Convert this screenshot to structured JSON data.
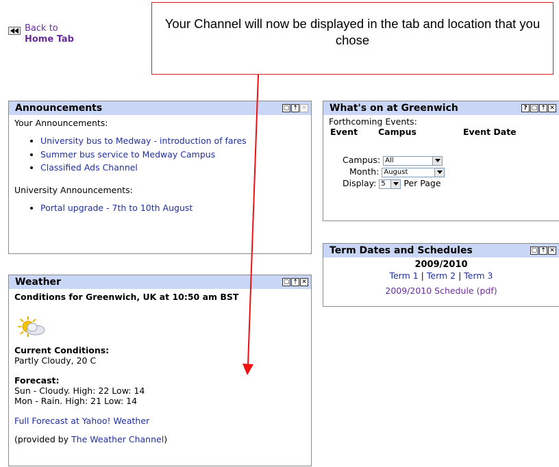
{
  "back": {
    "line1": "Back to",
    "line2": "Home Tab"
  },
  "callout": {
    "text": "Your Channel will now be displayed in the tab and location that you chose"
  },
  "announcements": {
    "title": "Announcements",
    "your_label": "Your Announcements:",
    "your_items": [
      "University bus to Medway - introduction of fares",
      "Summer bus service to Medway Campus",
      "Classified Ads Channel"
    ],
    "univ_label": "University Announcements:",
    "univ_items": [
      "Portal upgrade - 7th to 10th August"
    ]
  },
  "weather": {
    "title": "Weather",
    "conditions_title": "Conditions for Greenwich, UK at 10:50 am BST",
    "current_label": "Current Conditions:",
    "current_value": "Partly Cloudy, 20 C",
    "forecast_label": "Forecast:",
    "forecast": [
      "Sun - Cloudy. High: 22 Low: 14",
      "Mon - Rain. High: 21 Low: 14"
    ],
    "full_forecast_link": "Full Forecast at Yahoo! Weather",
    "provided_prefix": "(provided by ",
    "provided_link": "The Weather Channel",
    "provided_suffix": ")"
  },
  "greenwich": {
    "title": "What's on at Greenwich",
    "forthcoming": "Forthcoming Events:",
    "columns": [
      "Event",
      "Campus",
      "Event Date"
    ],
    "campus_label": "Campus:",
    "campus_value": "All",
    "month_label": "Month:",
    "month_value": "August",
    "display_label": "Display:",
    "display_value": "5",
    "per_page": "Per Page"
  },
  "term": {
    "title": "Term Dates and Schedules",
    "year": "2009/2010",
    "terms": [
      "Term 1",
      "Term 2",
      "Term 3"
    ],
    "separator": " | ",
    "schedule_link": "2009/2010 Schedule (pdf)"
  },
  "icons": {
    "rewind": "rewind-icon",
    "weather": "partly-cloudy-icon",
    "controls": [
      "help-icon",
      "maximize-icon",
      "minimize-icon",
      "close-icon"
    ]
  },
  "colors": {
    "header_bg": "#c9d6f5",
    "link": "#1f2f9e",
    "visited": "#6a2e9c",
    "callout_border": "#d21f1f"
  }
}
